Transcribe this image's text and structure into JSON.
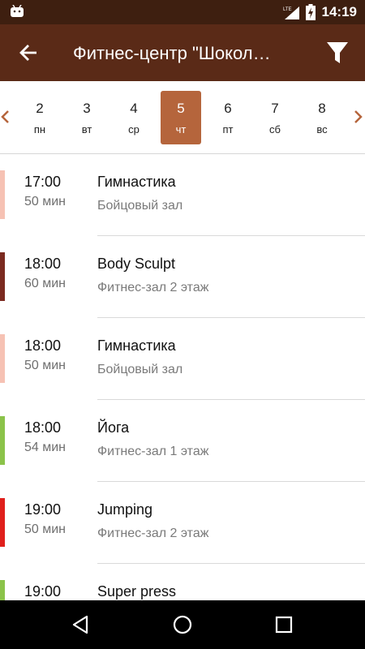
{
  "status_bar": {
    "time": "14:19",
    "network": "LTE"
  },
  "app_bar": {
    "title": "Фитнес-центр \"Шоколад\"",
    "back_icon": "arrow-left-icon",
    "filter_icon": "filter-icon"
  },
  "colors": {
    "status_bar": "#3e1f10",
    "app_bar": "#5a2a17",
    "accent": "#b5653c"
  },
  "dates": [
    {
      "num": "2",
      "weekday": "пн",
      "selected": false
    },
    {
      "num": "3",
      "weekday": "вт",
      "selected": false
    },
    {
      "num": "4",
      "weekday": "ср",
      "selected": false
    },
    {
      "num": "5",
      "weekday": "чт",
      "selected": true
    },
    {
      "num": "6",
      "weekday": "пт",
      "selected": false
    },
    {
      "num": "7",
      "weekday": "сб",
      "selected": false
    },
    {
      "num": "8",
      "weekday": "вс",
      "selected": false
    }
  ],
  "classes": [
    {
      "time": "17:00",
      "duration": "50 мин",
      "name": "Гимнастика",
      "room": "Бойцовый зал",
      "color": "#f6c2b4"
    },
    {
      "time": "18:00",
      "duration": "60 мин",
      "name": "Body Sculpt",
      "room": "Фитнес-зал 2 этаж",
      "color": "#7b2a20"
    },
    {
      "time": "18:00",
      "duration": "50 мин",
      "name": "Гимнастика",
      "room": "Бойцовый зал",
      "color": "#f6c2b4"
    },
    {
      "time": "18:00",
      "duration": "54 мин",
      "name": "Йога",
      "room": "Фитнес-зал 1 этаж",
      "color": "#8bc34a"
    },
    {
      "time": "19:00",
      "duration": "50 мин",
      "name": "Jumping",
      "room": "Фитнес-зал 2 этаж",
      "color": "#e0201c"
    },
    {
      "time": "19:00",
      "duration": "",
      "name": "Super press",
      "room": "",
      "color": "#8bc34a"
    }
  ],
  "nav": {
    "back": "nav-back-icon",
    "home": "nav-home-icon",
    "recents": "nav-recents-icon"
  }
}
